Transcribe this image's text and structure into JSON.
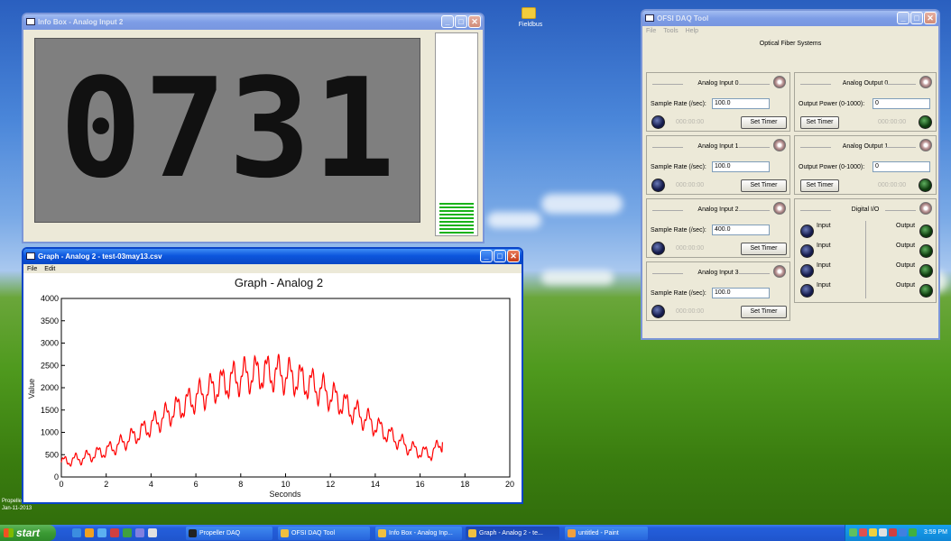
{
  "desktop": {
    "folder_label": "Fieldbus",
    "bottom_left_lines": [
      "Propeller",
      "Jan-11-2013"
    ]
  },
  "info_window": {
    "title": "Info Box - Analog Input 2",
    "display_value": "0731",
    "level_fraction": 0.18
  },
  "graph_window": {
    "title": "Graph - Analog 2 - test-03may13.csv",
    "menu": [
      "File",
      "Edit"
    ]
  },
  "daq_window": {
    "title": "OFSI DAQ Tool",
    "menu": [
      "File",
      "Tools",
      "Help"
    ],
    "subtitle": "Optical Fiber Systems",
    "analog_inputs": [
      {
        "name": "Analog Input 0",
        "rate_label": "Sample Rate (/sec):",
        "rate": "100.0",
        "timer": "000:00:00",
        "button": "Set Timer"
      },
      {
        "name": "Analog Input 1",
        "rate_label": "Sample Rate (/sec):",
        "rate": "100.0",
        "timer": "000:00:00",
        "button": "Set Timer"
      },
      {
        "name": "Analog Input 2",
        "rate_label": "Sample Rate (/sec):",
        "rate": "400.0",
        "timer": "000:00:00",
        "button": "Set Timer"
      },
      {
        "name": "Analog Input 3",
        "rate_label": "Sample Rate (/sec):",
        "rate": "100.0",
        "timer": "000:00:00",
        "button": "Set Timer"
      }
    ],
    "analog_outputs": [
      {
        "name": "Analog Output 0",
        "power_label": "Output Power (0-1000):",
        "power": "0",
        "timer": "000:00:00",
        "button": "Set Timer"
      },
      {
        "name": "Analog Output 1",
        "power_label": "Output Power (0-1000):",
        "power": "0",
        "timer": "000:00:00",
        "button": "Set Timer"
      }
    ],
    "digital_io": {
      "name": "Digital I/O",
      "input_label": "Input",
      "output_label": "Output"
    }
  },
  "taskbar": {
    "start_label": "start",
    "tasks": [
      "Propeller DAQ",
      "OFSI DAQ Tool",
      "Info Box - Analog Inp...",
      "Graph - Analog 2 - te...",
      "untitled - Paint"
    ],
    "clock": "3:59 PM"
  },
  "chart_data": {
    "type": "line",
    "title": "Graph - Analog 2",
    "xlabel": "Seconds",
    "ylabel": "Value",
    "xlim": [
      0,
      20
    ],
    "ylim": [
      0,
      4000
    ],
    "xticks": [
      0,
      2,
      4,
      6,
      8,
      10,
      12,
      14,
      16,
      18,
      20
    ],
    "yticks": [
      0,
      500,
      1000,
      1500,
      2000,
      2500,
      3000,
      3500,
      4000
    ],
    "series": [
      {
        "color": "#ff0000",
        "x": [
          0,
          0.5,
          1,
          1.5,
          2,
          2.5,
          3,
          3.5,
          4,
          4.5,
          5,
          5.5,
          6,
          6.5,
          7,
          7.5,
          8,
          8.5,
          9,
          9.5,
          10,
          10.5,
          11,
          11.5,
          12,
          12.5,
          13,
          13.5,
          14,
          14.5,
          15,
          15.5,
          16,
          16.5,
          17
        ],
        "y": [
          330,
          380,
          430,
          510,
          590,
          700,
          850,
          990,
          1150,
          1320,
          1480,
          1620,
          1780,
          1910,
          2040,
          2150,
          2240,
          2300,
          2330,
          2320,
          2280,
          2200,
          2100,
          1980,
          1830,
          1660,
          1480,
          1320,
          1150,
          980,
          820,
          660,
          560,
          520,
          780
        ]
      }
    ]
  }
}
